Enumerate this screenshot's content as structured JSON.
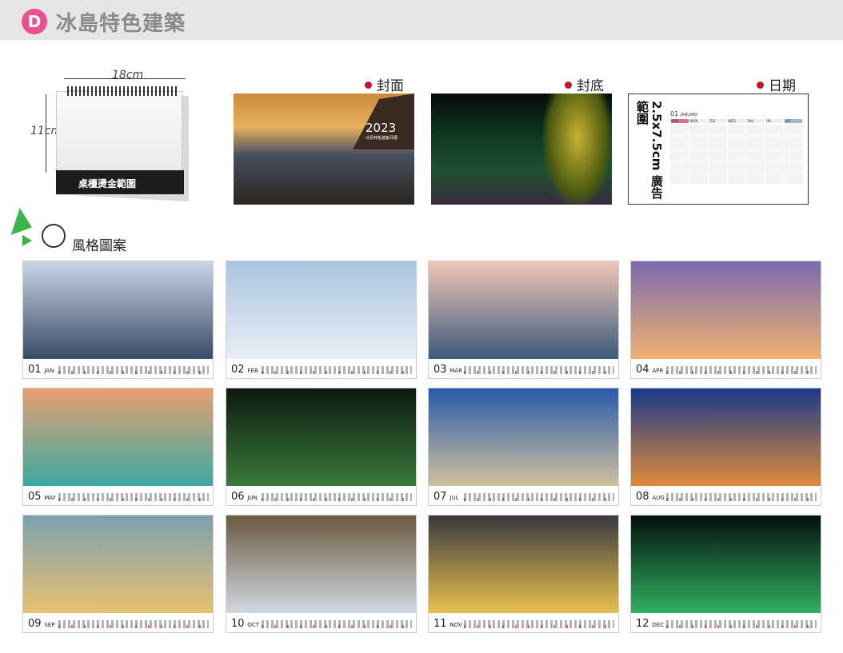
{
  "header": {
    "badge": "D",
    "title": "冰島特色建築"
  },
  "desk": {
    "width_label": "18cm",
    "height_label": "11cm",
    "base_label": "桌檯燙金範圍"
  },
  "labels": {
    "cover": "封面",
    "back": "封底",
    "date": "日期"
  },
  "cover_text": {
    "year": "2023",
    "sub": "冰島特色建築月曆"
  },
  "date_panel": {
    "ad_text": "2.5x7.5cm 廣告範圍",
    "month": "01",
    "month_name": "JANUARY",
    "weekdays": [
      "SUN",
      "MON",
      "TUE",
      "WED",
      "THU",
      "FRI",
      "SAT"
    ]
  },
  "style": {
    "label": "風格圖案"
  },
  "months": [
    {
      "num": "01",
      "abbr": "JAN",
      "colors": [
        "#c9d6e8",
        "#3a4a66"
      ]
    },
    {
      "num": "02",
      "abbr": "FEB",
      "colors": [
        "#a8c4e0",
        "#e9eef5"
      ]
    },
    {
      "num": "03",
      "abbr": "MAR",
      "colors": [
        "#f0c8b8",
        "#3c5a7c"
      ]
    },
    {
      "num": "04",
      "abbr": "APR",
      "colors": [
        "#7a6bb0",
        "#f0b070"
      ]
    },
    {
      "num": "05",
      "abbr": "MAY",
      "colors": [
        "#e8a070",
        "#3aa8a0"
      ]
    },
    {
      "num": "06",
      "abbr": "JUN",
      "colors": [
        "#0c1a10",
        "#3a7a3a"
      ]
    },
    {
      "num": "07",
      "abbr": "JUL",
      "colors": [
        "#2a5aa8",
        "#cfc0a0"
      ]
    },
    {
      "num": "08",
      "abbr": "AUG",
      "colors": [
        "#1a3a8a",
        "#e08a3a"
      ]
    },
    {
      "num": "09",
      "abbr": "SEP",
      "colors": [
        "#7aa0b0",
        "#e8c070"
      ]
    },
    {
      "num": "10",
      "abbr": "OCT",
      "colors": [
        "#6a5a40",
        "#d0d8e0"
      ]
    },
    {
      "num": "11",
      "abbr": "NOV",
      "colors": [
        "#3a3a40",
        "#e8c050"
      ]
    },
    {
      "num": "12",
      "abbr": "DEC",
      "colors": [
        "#04100c",
        "#30b060"
      ]
    }
  ]
}
